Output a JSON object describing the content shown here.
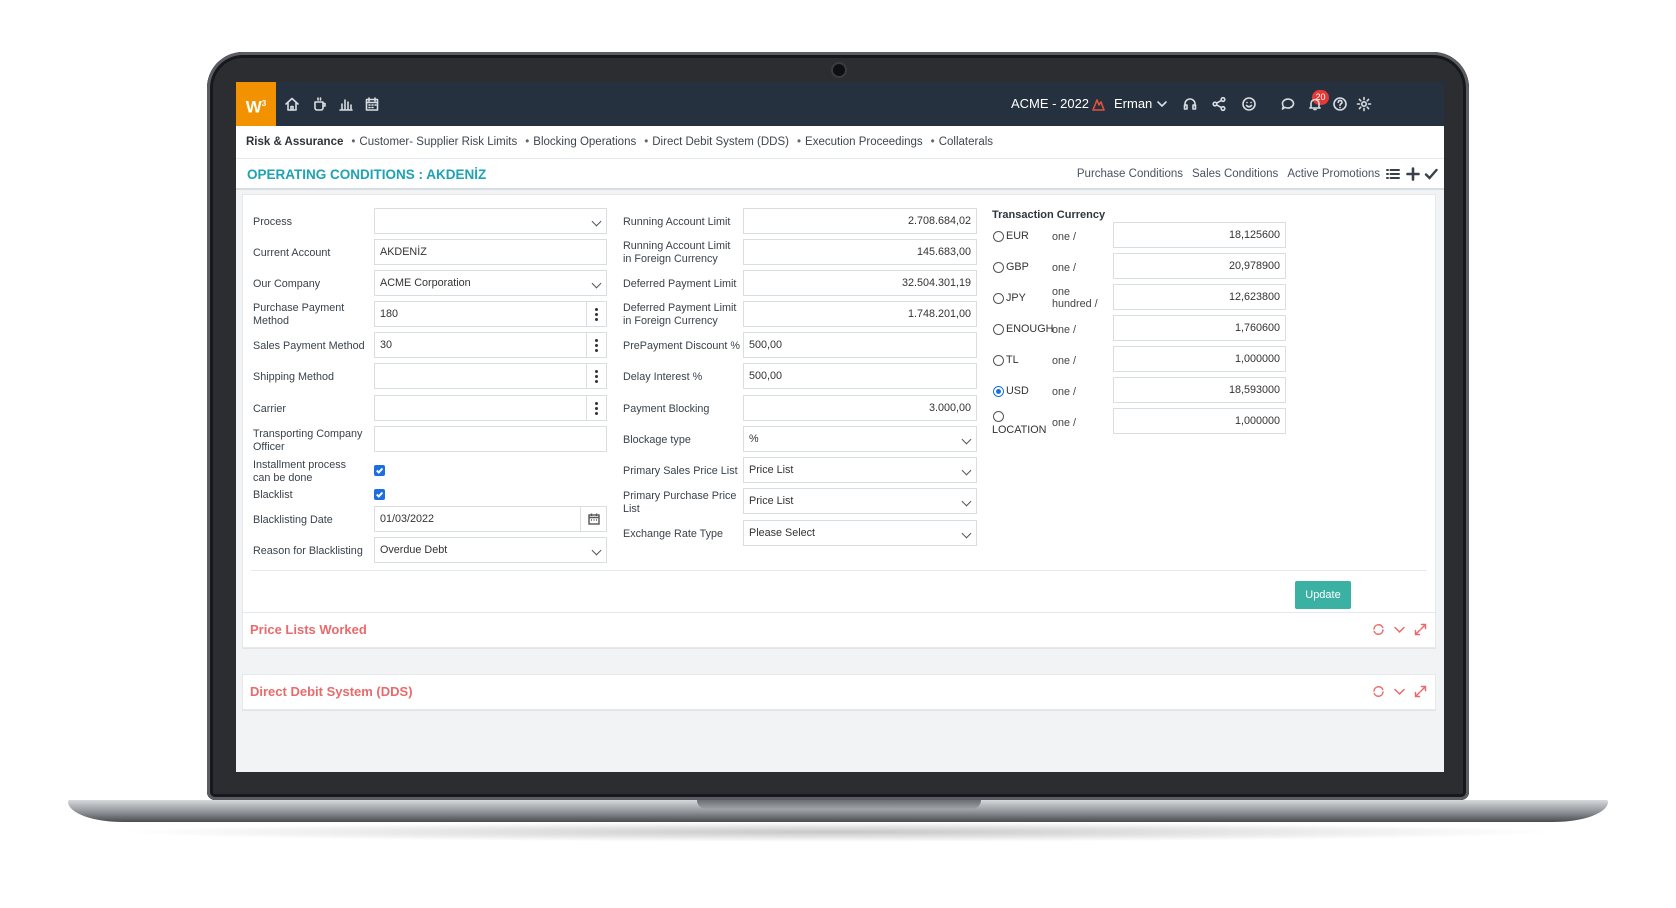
{
  "topbar": {
    "logo": "W",
    "logo_sup": "3",
    "company_year": "ACME - 2022",
    "user": "Erman",
    "notifications_count": "20"
  },
  "breadcrumb": {
    "current": "Risk & Assurance",
    "items": [
      "Customer- Supplier Risk Limits",
      "Blocking Operations",
      "Direct Debit System (DDS)",
      "Execution Proceedings",
      "Collaterals"
    ]
  },
  "page": {
    "title": "OPERATING CONDITIONS : AKDENİZ",
    "tabs": [
      "Purchase Conditions",
      "Sales Conditions",
      "Active Promotions"
    ]
  },
  "form_left": {
    "process": {
      "label": "Process",
      "value": ""
    },
    "current_account": {
      "label": "Current Account",
      "value": "AKDENİZ"
    },
    "our_company": {
      "label": "Our Company",
      "value": "ACME Corporation"
    },
    "purchase_payment_method": {
      "label": "Purchase Payment Method",
      "value": "180"
    },
    "sales_payment_method": {
      "label": "Sales Payment Method",
      "value": "30"
    },
    "shipping_method": {
      "label": "Shipping Method",
      "value": ""
    },
    "carrier": {
      "label": "Carrier",
      "value": ""
    },
    "transporting_officer": {
      "label": "Transporting Company Officer",
      "value": ""
    },
    "installment": {
      "label": "Installment process can be done",
      "checked": true
    },
    "blacklist": {
      "label": "Blacklist",
      "checked": true
    },
    "blacklisting_date": {
      "label": "Blacklisting Date",
      "value": "01/03/2022"
    },
    "reason_blacklisting": {
      "label": "Reason for Blacklisting",
      "value": "Overdue Debt"
    }
  },
  "form_mid": {
    "running_account_limit": {
      "label": "Running Account Limit",
      "value": "2.708.684,02"
    },
    "running_account_limit_fc": {
      "label": "Running Account Limit in Foreign Currency",
      "value": "145.683,00"
    },
    "deferred_payment_limit": {
      "label": "Deferred Payment Limit",
      "value": "32.504.301,19"
    },
    "deferred_payment_limit_fc": {
      "label": "Deferred Payment Limit in Foreign Currency",
      "value": "1.748.201,00"
    },
    "prepayment_discount": {
      "label": "PrePayment Discount %",
      "value": "500,00"
    },
    "delay_interest": {
      "label": "Delay Interest %",
      "value": "500,00"
    },
    "payment_blocking": {
      "label": "Payment Blocking",
      "value": "3.000,00"
    },
    "blockage_type": {
      "label": "Blockage type",
      "value": "%"
    },
    "primary_sales_price_list": {
      "label": "Primary Sales Price List",
      "value": "Price List"
    },
    "primary_purchase_price_list": {
      "label": "Primary Purchase Price List",
      "value": "Price List"
    },
    "exchange_rate_type": {
      "label": "Exchange Rate Type",
      "value": "Please Select"
    }
  },
  "currency": {
    "title": "Transaction Currency",
    "rows": [
      {
        "code": "EUR",
        "unit": "one /",
        "rate": "18,125600",
        "selected": false
      },
      {
        "code": "GBP",
        "unit": "one /",
        "rate": "20,978900",
        "selected": false
      },
      {
        "code": "JPY",
        "unit": "one hundred /",
        "rate": "12,623800",
        "selected": false
      },
      {
        "code": "ENOUGH",
        "unit": "one /",
        "rate": "1,760600",
        "selected": false
      },
      {
        "code": "TL",
        "unit": "one /",
        "rate": "1,000000",
        "selected": false
      },
      {
        "code": "USD",
        "unit": "one /",
        "rate": "18,593000",
        "selected": true
      },
      {
        "code": "LOCATION",
        "unit": "one /",
        "rate": "1,000000",
        "selected": false
      }
    ]
  },
  "actions": {
    "update": "Update"
  },
  "panels": {
    "price_lists": "Price Lists Worked",
    "dds": "Direct Debit System (DDS)"
  },
  "colors": {
    "accent_teal": "#1ea2b4",
    "button_green": "#3bb1a4",
    "panel_red": "#e86b6b",
    "logo_orange": "#f39200",
    "topbar": "#263140"
  }
}
